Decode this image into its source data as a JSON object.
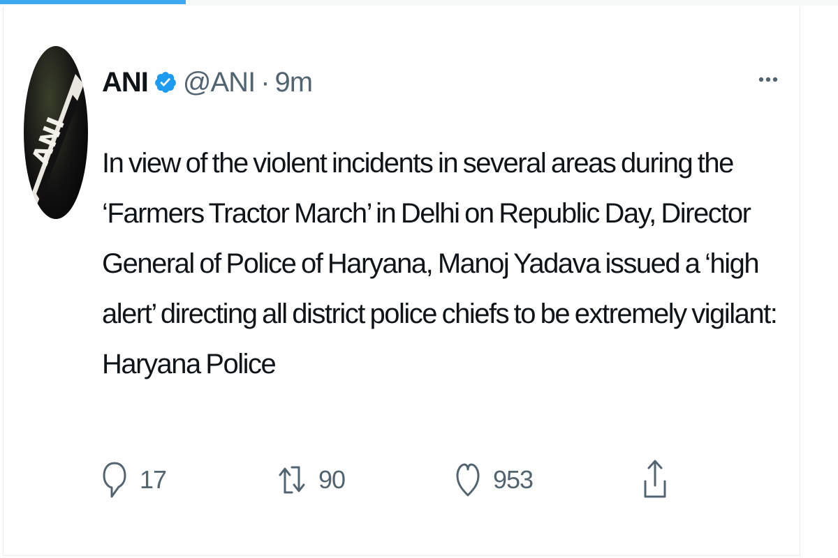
{
  "tweet": {
    "author_name": "ANI",
    "handle": "@ANI",
    "separator": "·",
    "timestamp": "9m",
    "avatar_text": "ANI",
    "text": "In view of the violent incidents in several areas during the ‘Farmers Tractor March’ in Delhi on Republic Day, Director General of Police of Haryana, Manoj Yadava issued a ‘high alert’ directing all district police chiefs to be extremely vigilant: Haryana Police"
  },
  "actions": {
    "reply_count": "17",
    "retweet_count": "90",
    "like_count": "953"
  },
  "icons": {
    "verified": "verified-badge-icon",
    "more": "more-options-icon",
    "reply": "reply-icon",
    "retweet": "retweet-icon",
    "like": "heart-icon",
    "share": "share-icon"
  },
  "colors": {
    "accent": "#1d9bf0",
    "text": "#0f1419",
    "muted": "#536471"
  }
}
